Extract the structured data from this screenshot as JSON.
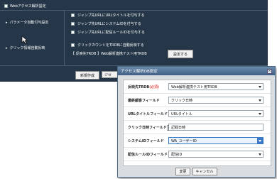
{
  "background": {
    "title": "Webアクセス解析設定",
    "params_label": "パラメータ自動付与設定",
    "click_label": "クリック情報自動反映",
    "options": [
      "ジャンプ先URLにURLタイトルを付与する",
      "ジャンプ先URLにシステムIDを付与する",
      "ジャンプ先URLに配信ルールIDを付与する"
    ],
    "click_option": "クリックカウントをTRDBに自動反映する",
    "reflect_text": "【 反映先TRDB 】Web解析連携テスト用TRDB",
    "settings_button": "設定する",
    "new_button": "新規作成",
    "other_button": "ジセ"
  },
  "dialog": {
    "title": "アクセス解析DB設定",
    "close_icon": "×",
    "rows": [
      {
        "label": "反映先TRDB",
        "required": "(必須)",
        "value": "Web解析連携テスト用TRDB",
        "type": "select"
      },
      {
        "label": "最終顧客フィールド",
        "required": "",
        "value": "クリック日時",
        "type": "select"
      },
      {
        "label": "URLタイトルフィールド",
        "required": "",
        "value": "URLタイトル",
        "type": "select"
      },
      {
        "label": "クリック日時フィールド",
        "required": "",
        "value": "記録日時",
        "type": "text"
      },
      {
        "label": "システムIDフィールド",
        "required": "",
        "value": "WA_ユーザーID",
        "type": "select-active"
      },
      {
        "label": "配信ルールIDフィールド",
        "required": "",
        "value": "配信ID",
        "type": "select"
      }
    ],
    "change_button": "変更",
    "cancel_button": "キャンセル"
  }
}
